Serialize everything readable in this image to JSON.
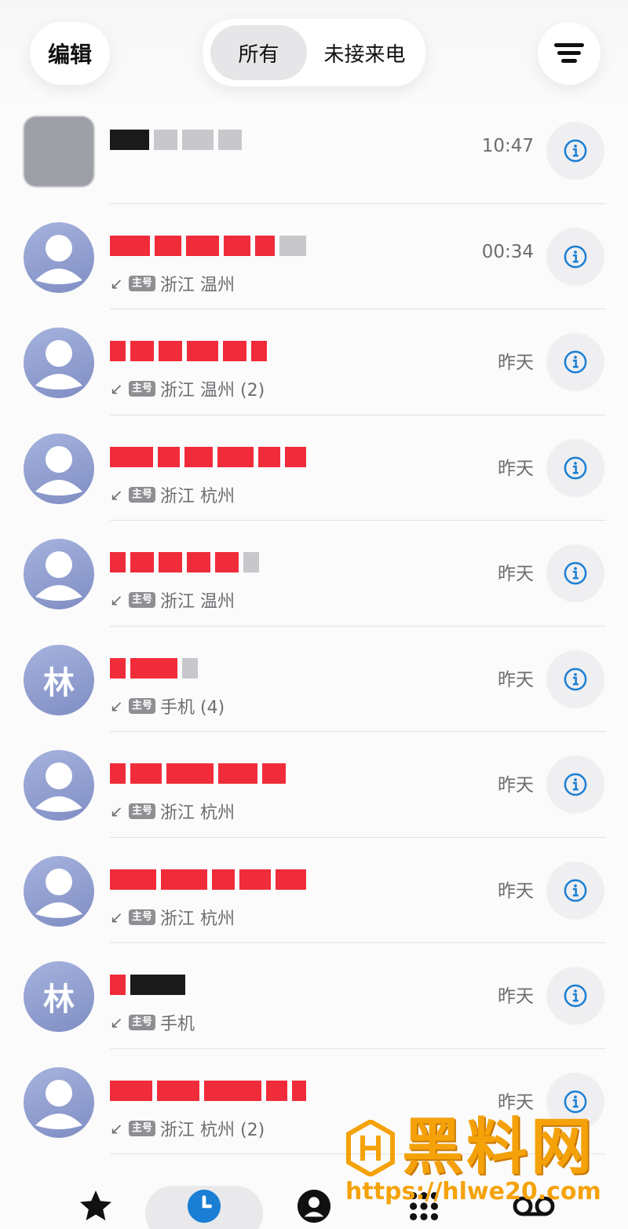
{
  "header": {
    "edit_label": "编辑",
    "segment_all": "所有",
    "segment_missed": "未接来电"
  },
  "sim_label": "主号",
  "calls": [
    {
      "avatar": "blurred",
      "initial": "",
      "meta": "",
      "time": "10:47"
    },
    {
      "avatar": "person",
      "initial": "",
      "meta": "浙江 温州",
      "time": "00:34"
    },
    {
      "avatar": "person",
      "initial": "",
      "meta": "浙江 温州 (2)",
      "time": "昨天"
    },
    {
      "avatar": "person",
      "initial": "",
      "meta": "浙江 杭州",
      "time": "昨天"
    },
    {
      "avatar": "person",
      "initial": "",
      "meta": "浙江 温州",
      "time": "昨天"
    },
    {
      "avatar": "initial",
      "initial": "林",
      "meta": "手机 (4)",
      "time": "昨天"
    },
    {
      "avatar": "person",
      "initial": "",
      "meta": "浙江 杭州",
      "time": "昨天"
    },
    {
      "avatar": "person",
      "initial": "",
      "meta": "浙江 杭州",
      "time": "昨天"
    },
    {
      "avatar": "initial",
      "initial": "林",
      "meta": "手机",
      "time": "昨天"
    },
    {
      "avatar": "person",
      "initial": "",
      "meta": "浙江 杭州 (2)",
      "time": "昨天"
    }
  ],
  "tabs": [
    "favorites-icon",
    "recents-icon",
    "contacts-icon",
    "keypad-icon",
    "voicemail-icon"
  ],
  "colors": {
    "accent": "#1a7fd4",
    "redact": "#f02c3a",
    "avatar": "#8e9bd0"
  },
  "watermark": {
    "title": "黑料网",
    "url": "https://hlwe20.com"
  }
}
